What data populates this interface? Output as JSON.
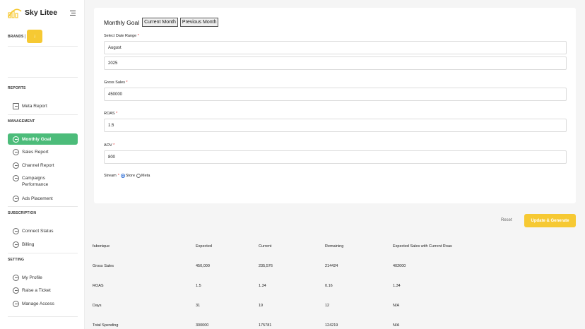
{
  "app": {
    "name": "Sky Litee"
  },
  "brand": {
    "colors": {
      "accent": "#f6c933",
      "active_nav": "#4cbc7a"
    }
  },
  "sidebar": {
    "brands_label": "BRANDS",
    "brands_sep": "|",
    "brand_button": "↓",
    "sections": [
      {
        "title": "REPORTS",
        "items": [
          {
            "label": "Meta Report",
            "icon": "report-icon"
          }
        ]
      },
      {
        "title": "MANAGEMENT",
        "items": [
          {
            "label": "Monthly Goal",
            "icon": "chat-icon",
            "active": true
          },
          {
            "label": "Sales Report",
            "icon": "chat-icon"
          },
          {
            "label": "Channel Report",
            "icon": "chat-icon"
          },
          {
            "label": "Campaigns Performance",
            "icon": "chat-icon"
          },
          {
            "label": "Ads Placement",
            "icon": "chat-icon"
          }
        ]
      },
      {
        "title": "SUBSCRIPTION",
        "items": [
          {
            "label": "Connect Status",
            "icon": "circle-icon"
          },
          {
            "label": "Billing",
            "icon": "circle-icon"
          }
        ]
      },
      {
        "title": "SETTING",
        "items": [
          {
            "label": "My Profile",
            "icon": "chat-icon"
          },
          {
            "label": "Raise a Ticket",
            "icon": "chat-icon"
          },
          {
            "label": "Manage Access",
            "icon": "circle-icon"
          }
        ]
      }
    ]
  },
  "form": {
    "title": "Monthly Goal",
    "current_month_button": "Current Month",
    "previous_month_button": "Previous Month",
    "date_range_label": "Select Date Range",
    "month_value": "August",
    "year_value": "2025",
    "gross_sales_label": "Gross Sales",
    "gross_sales_value": "450000",
    "roas_label": "ROAS",
    "roas_value": "1.5",
    "aov_label": "AOV",
    "aov_value": "800",
    "stream_label": "Stream",
    "required_mark": "*",
    "stream_options": [
      {
        "label": "Store",
        "selected": true
      },
      {
        "label": "Meta",
        "selected": false
      }
    ],
    "reset_button": "Reset",
    "update_button": "Update & Generate"
  },
  "table": {
    "headers": [
      "fabonique",
      "Expected",
      "Current",
      "Remaining",
      "Expected Sales with Current Roas"
    ],
    "rows": [
      [
        "Gross Sales",
        "450,000",
        "235,576",
        "214424",
        "402000"
      ],
      [
        "ROAS",
        "1.5",
        "1.34",
        "0.16",
        "1.34"
      ],
      [
        "Days",
        "31",
        "19",
        "12",
        "N/A"
      ],
      [
        "Total Spending",
        "300000",
        "175781",
        "124219",
        "N/A"
      ]
    ]
  }
}
